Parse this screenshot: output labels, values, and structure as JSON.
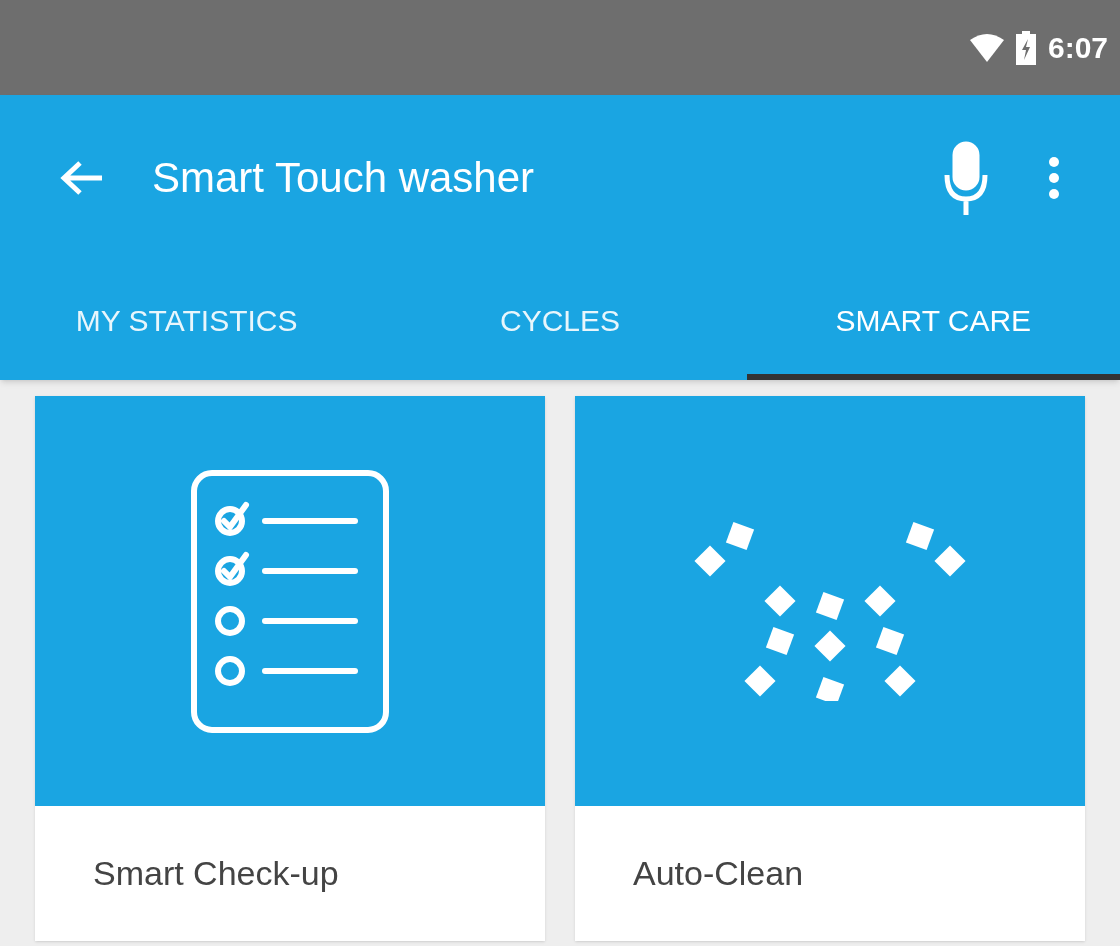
{
  "status_bar": {
    "time": "6:07"
  },
  "app_bar": {
    "title": "Smart Touch washer"
  },
  "tabs": [
    {
      "label": "MY STATISTICS",
      "selected": false
    },
    {
      "label": "CYCLES",
      "selected": false
    },
    {
      "label": "SMART CARE",
      "selected": true
    }
  ],
  "cards": [
    {
      "title": "Smart Check-up",
      "kind": "checklist"
    },
    {
      "title": "Auto-Clean",
      "kind": "spray"
    }
  ]
}
